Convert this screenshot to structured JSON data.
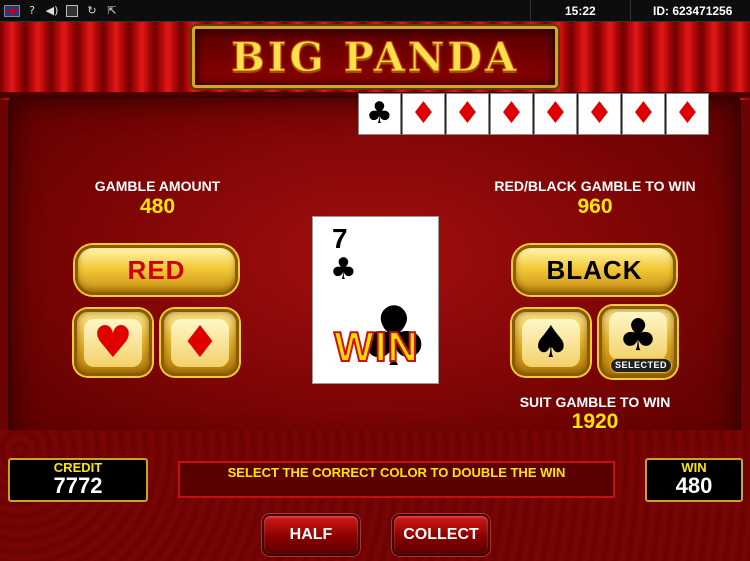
{
  "sysbar": {
    "icons": [
      "uk-flag-icon",
      "help-icon",
      "sound-icon",
      "fullscreen-icon",
      "reload-icon",
      "exit-icon"
    ],
    "help_glyph": "?",
    "sound_glyph": "◀)",
    "reload_glyph": "↻",
    "exit_glyph": "⇱",
    "time": "15:22",
    "id_text": "ID: 623471256"
  },
  "game": {
    "title": "BIG PANDA",
    "history_cards": [
      {
        "suit": "club",
        "glyph": "♣",
        "color": "#000000"
      },
      {
        "suit": "diamond",
        "glyph": "♦",
        "color": "#e00000"
      },
      {
        "suit": "diamond",
        "glyph": "♦",
        "color": "#e00000"
      },
      {
        "suit": "diamond",
        "glyph": "♦",
        "color": "#e00000"
      },
      {
        "suit": "diamond",
        "glyph": "♦",
        "color": "#e00000"
      },
      {
        "suit": "diamond",
        "glyph": "♦",
        "color": "#e00000"
      },
      {
        "suit": "diamond",
        "glyph": "♦",
        "color": "#e00000"
      },
      {
        "suit": "diamond",
        "glyph": "♦",
        "color": "#e00000"
      }
    ],
    "gamble_amount_label": "GAMBLE AMOUNT",
    "gamble_amount_value": "480",
    "red_black_label": "RED/BLACK GAMBLE TO WIN",
    "red_black_value": "960",
    "suit_gamble_label": "SUIT GAMBLE TO WIN",
    "suit_gamble_value": "1920",
    "red_button": "RED",
    "black_button": "BLACK",
    "heart_glyph": "♥",
    "diamond_glyph": "♦",
    "spade_glyph": "♠",
    "club_glyph": "♣",
    "selected_tag": "SELECTED",
    "current_card": {
      "rank": "7",
      "suit_glyph": "♣",
      "result": "WIN"
    }
  },
  "bottom": {
    "credit_label": "CREDIT",
    "credit_value": "7772",
    "message": "SELECT THE CORRECT COLOR TO DOUBLE THE WIN",
    "win_label": "WIN",
    "win_value": "480",
    "half_button": "HALF",
    "collect_button": "COLLECT"
  },
  "colors": {
    "accent_gold": "#ffe600",
    "panel_red": "#8b0000",
    "frame_gold": "#c9a227"
  }
}
